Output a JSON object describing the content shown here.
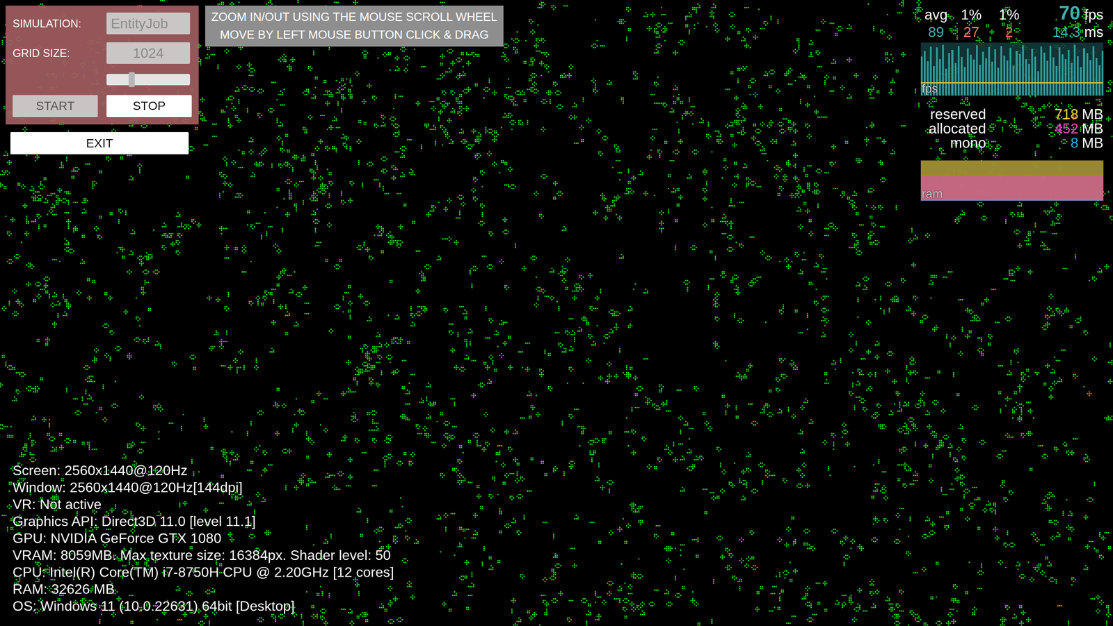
{
  "control_panel": {
    "fields": [
      {
        "label": "SIMULATION:",
        "value": "EntityJob",
        "kind": "dropdown"
      },
      {
        "label": "GRID SIZE:",
        "value": "1024",
        "kind": "input"
      }
    ],
    "slider": {
      "level": 0.3
    },
    "buttons": [
      {
        "label": "START",
        "disabled": true
      },
      {
        "label": "STOP",
        "disabled": false
      }
    ]
  },
  "exit_button": {
    "label": "EXIT"
  },
  "instructions": [
    "ZOOM IN/OUT USING THE MOUSE SCROLL WHEEL",
    "MOVE BY LEFT MOUSE BUTTON CLICK & DRAG"
  ],
  "stats": {
    "headers": [
      "avg",
      "1%",
      "1%"
    ],
    "readings": [
      {
        "value": "89",
        "color": "#3fb0ad"
      },
      {
        "value": "27",
        "color": "#e8786a"
      },
      {
        "value": "2",
        "color": "#e0604e"
      }
    ],
    "fps": {
      "value": "70",
      "unit": "fps"
    },
    "ms": {
      "value": "14.3",
      "unit": "ms"
    },
    "fps_graph": {
      "label": "fps",
      "reference": 30,
      "values": [
        96,
        110,
        84,
        120,
        72,
        118,
        90,
        125,
        66,
        104,
        112,
        80,
        122,
        95,
        70,
        116,
        100,
        88,
        124,
        76,
        108,
        92,
        119,
        83,
        114,
        68,
        121,
        98,
        86,
        117,
        74,
        110,
        102,
        124,
        90,
        78,
        115,
        96,
        60,
        120,
        106,
        85,
        123,
        94,
        72,
        118,
        101,
        89,
        112,
        80,
        125,
        97,
        70,
        116,
        104,
        87,
        121,
        93,
        75,
        110
      ]
    },
    "memory": [
      {
        "label": "reserved",
        "value": "718",
        "unit": "MB",
        "color": "#e6d440",
        "level": 1
      },
      {
        "label": "allocated",
        "value": "452",
        "unit": "MB",
        "color": "#e050b8",
        "level": 0.63
      },
      {
        "label": "mono",
        "value": "8",
        "unit": "MB",
        "color": "#30a8e0",
        "level": 0.02
      }
    ],
    "ram_graph": {
      "label": "ram"
    }
  },
  "system_info": [
    "Screen: 2560x1440@120Hz",
    "Window: 2560x1440@120Hz[144dpi]",
    "VR: Not active",
    "Graphics API: Direct3D 11.0 [level 11.1]",
    "GPU: NVIDIA GeForce GTX 1080",
    "VRAM: 8059MB. Max texture size: 16384px. Shader level: 50",
    "CPU: Intel(R) Core(TM) i7-8750H CPU @ 2.20GHz [12 cores]",
    "RAM: 32626 MB",
    "OS: Windows 11  (10.0.22631) 64bit [Desktop]"
  ]
}
